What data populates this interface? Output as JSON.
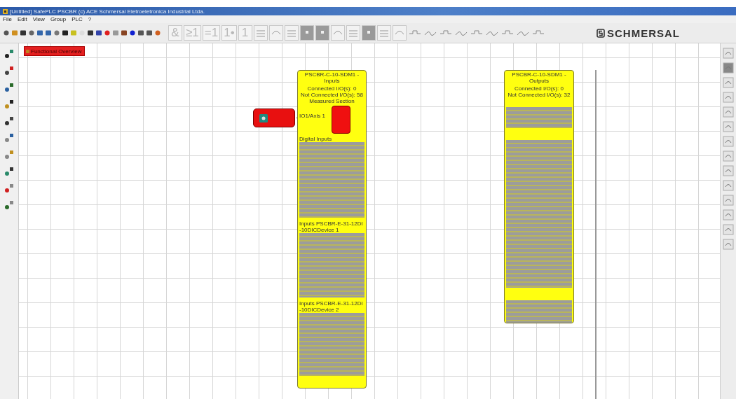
{
  "window": {
    "title": "[Untitled] SafePLC PSCBR (c) ACE Schmersal Eletroeletronica Industrial Ltda."
  },
  "menu": [
    "File",
    "Edit",
    "View",
    "Group",
    "PLC",
    "?"
  ],
  "toolbar": {
    "gates": [
      "&",
      "≥1",
      "=1",
      "1•",
      "1"
    ],
    "logo": "SCHMERSAL"
  },
  "canvas": {
    "tag": "Functional Overview",
    "blocks": [
      {
        "title": "PSCBR-C-10-SDM1 - Inputs",
        "lines": [
          "Connected I/O(s): 0",
          "Not Connected I/O(s): 58",
          "Measured Section"
        ],
        "port": "IO1/Axis 1",
        "sections": [
          {
            "kind": "label",
            "text": "Digital Inputs"
          },
          {
            "kind": "slots"
          },
          {
            "kind": "label",
            "text": "Inputs PSCBR-E-31-12DI-10DICDevice 1"
          },
          {
            "kind": "slots"
          },
          {
            "kind": "label",
            "text": "Inputs PSCBR-E-31-12DI-10DICDevice 2"
          },
          {
            "kind": "slots"
          },
          {
            "kind": "spacer"
          }
        ]
      },
      {
        "title": "PSCBR-C-10-SDM1 - Outputs",
        "lines": [
          "Connected I/O(s): 0",
          "Not Connected I/O(s): 32"
        ],
        "sections": [
          {
            "kind": "slots"
          },
          {
            "kind": "spacer"
          },
          {
            "kind": "slots"
          },
          {
            "kind": "spacer"
          },
          {
            "kind": "slots"
          }
        ]
      }
    ]
  }
}
